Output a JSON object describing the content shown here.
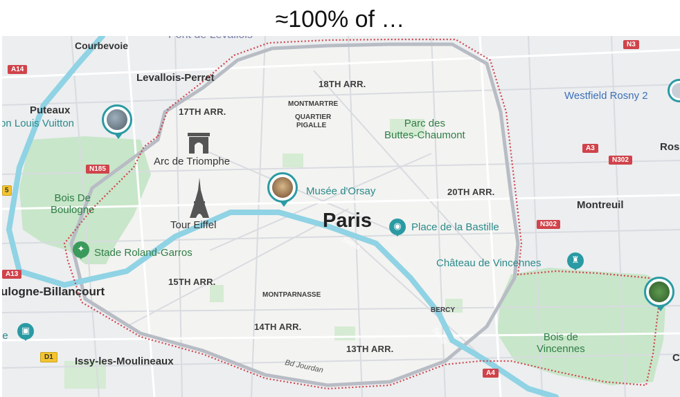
{
  "title": "≈100% of …",
  "map": {
    "city": "Paris",
    "river": "Seine",
    "river2": "Seine",
    "street": "Bd Jourdan",
    "arrondissements": {
      "a18": "18TH ARR.",
      "a17": "17TH ARR.",
      "a20": "20TH ARR.",
      "a15": "15TH ARR.",
      "a14": "14TH ARR.",
      "a13": "13TH ARR."
    },
    "neighborhoods": {
      "montmartre": "MONTMARTRE",
      "quartier": "QUARTIER",
      "pigalle": "PIGALLE",
      "montparnasse": "MONTPARNASSE",
      "bercy": "BERCY"
    },
    "towns": {
      "courbevoie": "Courbevoie",
      "levallois": "Levallois-Perret",
      "puteaux": "Puteaux",
      "boulogne": "ulogne-Billancourt",
      "issy": "Issy-les-Moulineaux",
      "montreuil": "Montreuil",
      "rosny": "Ros",
      "right_c": "C",
      "pont": "Pont de Levallois"
    },
    "pois": {
      "louis_vuitton": "on Louis Vuitton",
      "arc": "Arc de Triomphe",
      "eiffel": "Tour Eiffel",
      "orsay": "Musée d'Orsay",
      "bastille": "Place de la Bastille",
      "roland_garros": "Stade Roland-Garros",
      "vincennes_chateau": "Château de Vincennes",
      "westfield": "Westfield Rosny 2",
      "left_e": "le"
    },
    "parks": {
      "boulogne_1": "Bois De",
      "boulogne_2": "Boulogne",
      "buttes_1": "Parc des",
      "buttes_2": "Buttes-Chaumont",
      "vincennes_1": "Bois de",
      "vincennes_2": "Vincennes"
    },
    "road_shields": {
      "a14": "A14",
      "n185": "N185",
      "n3": "N3",
      "a3": "A3",
      "n302a": "N302",
      "n302b": "N302",
      "a13": "A13",
      "d1": "D1",
      "a4": "A4",
      "five": "5"
    },
    "icons": {
      "arc": "arc-de-triomphe-icon",
      "eiffel": "eiffel-tower-icon",
      "camera": "camera-icon",
      "tennis": "stadium-icon",
      "castle": "castle-icon",
      "photo_pin": "photo-pin-icon"
    },
    "colors": {
      "park": "#c8e6c9",
      "water": "#8fd3e4",
      "boundary": "#d0434a",
      "poi_teal": "#2a9aa3"
    }
  }
}
